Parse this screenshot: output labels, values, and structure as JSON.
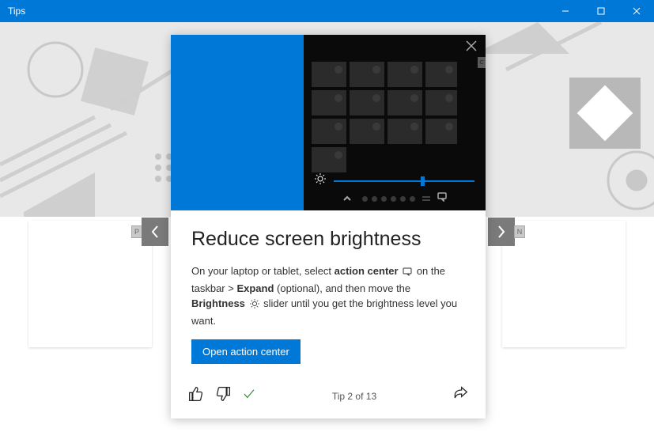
{
  "window": {
    "title": "Tips"
  },
  "nav": {
    "prev_key": "P",
    "next_key": "N"
  },
  "tip": {
    "title": "Reduce screen brightness",
    "desc": {
      "part1": "On your laptop or tablet, select ",
      "bold1": "action center",
      "part2": " on the taskbar > ",
      "bold2": "Expand",
      "part3": " (optional), and then move the ",
      "bold3": "Brightness",
      "part4": " slider until you get the brightness level you want."
    },
    "cta": "Open action center",
    "counter": "Tip 2 of 13"
  },
  "illus": {
    "scroll_label": "C"
  }
}
